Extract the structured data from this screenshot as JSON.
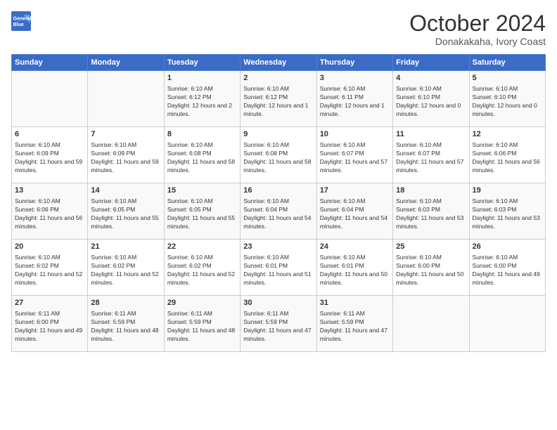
{
  "logo": {
    "line1": "General",
    "line2": "Blue"
  },
  "title": "October 2024",
  "subtitle": "Donakakaha, Ivory Coast",
  "weekdays": [
    "Sunday",
    "Monday",
    "Tuesday",
    "Wednesday",
    "Thursday",
    "Friday",
    "Saturday"
  ],
  "weeks": [
    [
      {
        "num": "",
        "sunrise": "",
        "sunset": "",
        "daylight": ""
      },
      {
        "num": "",
        "sunrise": "",
        "sunset": "",
        "daylight": ""
      },
      {
        "num": "1",
        "sunrise": "Sunrise: 6:10 AM",
        "sunset": "Sunset: 6:12 PM",
        "daylight": "Daylight: 12 hours and 2 minutes."
      },
      {
        "num": "2",
        "sunrise": "Sunrise: 6:10 AM",
        "sunset": "Sunset: 6:12 PM",
        "daylight": "Daylight: 12 hours and 1 minute."
      },
      {
        "num": "3",
        "sunrise": "Sunrise: 6:10 AM",
        "sunset": "Sunset: 6:11 PM",
        "daylight": "Daylight: 12 hours and 1 minute."
      },
      {
        "num": "4",
        "sunrise": "Sunrise: 6:10 AM",
        "sunset": "Sunset: 6:10 PM",
        "daylight": "Daylight: 12 hours and 0 minutes."
      },
      {
        "num": "5",
        "sunrise": "Sunrise: 6:10 AM",
        "sunset": "Sunset: 6:10 PM",
        "daylight": "Daylight: 12 hours and 0 minutes."
      }
    ],
    [
      {
        "num": "6",
        "sunrise": "Sunrise: 6:10 AM",
        "sunset": "Sunset: 6:09 PM",
        "daylight": "Daylight: 11 hours and 59 minutes."
      },
      {
        "num": "7",
        "sunrise": "Sunrise: 6:10 AM",
        "sunset": "Sunset: 6:09 PM",
        "daylight": "Daylight: 11 hours and 59 minutes."
      },
      {
        "num": "8",
        "sunrise": "Sunrise: 6:10 AM",
        "sunset": "Sunset: 6:08 PM",
        "daylight": "Daylight: 11 hours and 58 minutes."
      },
      {
        "num": "9",
        "sunrise": "Sunrise: 6:10 AM",
        "sunset": "Sunset: 6:08 PM",
        "daylight": "Daylight: 11 hours and 58 minutes."
      },
      {
        "num": "10",
        "sunrise": "Sunrise: 6:10 AM",
        "sunset": "Sunset: 6:07 PM",
        "daylight": "Daylight: 11 hours and 57 minutes."
      },
      {
        "num": "11",
        "sunrise": "Sunrise: 6:10 AM",
        "sunset": "Sunset: 6:07 PM",
        "daylight": "Daylight: 11 hours and 57 minutes."
      },
      {
        "num": "12",
        "sunrise": "Sunrise: 6:10 AM",
        "sunset": "Sunset: 6:06 PM",
        "daylight": "Daylight: 11 hours and 56 minutes."
      }
    ],
    [
      {
        "num": "13",
        "sunrise": "Sunrise: 6:10 AM",
        "sunset": "Sunset: 6:06 PM",
        "daylight": "Daylight: 11 hours and 56 minutes."
      },
      {
        "num": "14",
        "sunrise": "Sunrise: 6:10 AM",
        "sunset": "Sunset: 6:05 PM",
        "daylight": "Daylight: 11 hours and 55 minutes."
      },
      {
        "num": "15",
        "sunrise": "Sunrise: 6:10 AM",
        "sunset": "Sunset: 6:05 PM",
        "daylight": "Daylight: 11 hours and 55 minutes."
      },
      {
        "num": "16",
        "sunrise": "Sunrise: 6:10 AM",
        "sunset": "Sunset: 6:04 PM",
        "daylight": "Daylight: 11 hours and 54 minutes."
      },
      {
        "num": "17",
        "sunrise": "Sunrise: 6:10 AM",
        "sunset": "Sunset: 6:04 PM",
        "daylight": "Daylight: 11 hours and 54 minutes."
      },
      {
        "num": "18",
        "sunrise": "Sunrise: 6:10 AM",
        "sunset": "Sunset: 6:03 PM",
        "daylight": "Daylight: 11 hours and 53 minutes."
      },
      {
        "num": "19",
        "sunrise": "Sunrise: 6:10 AM",
        "sunset": "Sunset: 6:03 PM",
        "daylight": "Daylight: 11 hours and 53 minutes."
      }
    ],
    [
      {
        "num": "20",
        "sunrise": "Sunrise: 6:10 AM",
        "sunset": "Sunset: 6:02 PM",
        "daylight": "Daylight: 11 hours and 52 minutes."
      },
      {
        "num": "21",
        "sunrise": "Sunrise: 6:10 AM",
        "sunset": "Sunset: 6:02 PM",
        "daylight": "Daylight: 11 hours and 52 minutes."
      },
      {
        "num": "22",
        "sunrise": "Sunrise: 6:10 AM",
        "sunset": "Sunset: 6:02 PM",
        "daylight": "Daylight: 11 hours and 52 minutes."
      },
      {
        "num": "23",
        "sunrise": "Sunrise: 6:10 AM",
        "sunset": "Sunset: 6:01 PM",
        "daylight": "Daylight: 11 hours and 51 minutes."
      },
      {
        "num": "24",
        "sunrise": "Sunrise: 6:10 AM",
        "sunset": "Sunset: 6:01 PM",
        "daylight": "Daylight: 11 hours and 50 minutes."
      },
      {
        "num": "25",
        "sunrise": "Sunrise: 6:10 AM",
        "sunset": "Sunset: 6:00 PM",
        "daylight": "Daylight: 11 hours and 50 minutes."
      },
      {
        "num": "26",
        "sunrise": "Sunrise: 6:10 AM",
        "sunset": "Sunset: 6:00 PM",
        "daylight": "Daylight: 11 hours and 49 minutes."
      }
    ],
    [
      {
        "num": "27",
        "sunrise": "Sunrise: 6:11 AM",
        "sunset": "Sunset: 6:00 PM",
        "daylight": "Daylight: 11 hours and 49 minutes."
      },
      {
        "num": "28",
        "sunrise": "Sunrise: 6:11 AM",
        "sunset": "Sunset: 5:59 PM",
        "daylight": "Daylight: 11 hours and 48 minutes."
      },
      {
        "num": "29",
        "sunrise": "Sunrise: 6:11 AM",
        "sunset": "Sunset: 5:59 PM",
        "daylight": "Daylight: 11 hours and 48 minutes."
      },
      {
        "num": "30",
        "sunrise": "Sunrise: 6:11 AM",
        "sunset": "Sunset: 5:59 PM",
        "daylight": "Daylight: 11 hours and 47 minutes."
      },
      {
        "num": "31",
        "sunrise": "Sunrise: 6:11 AM",
        "sunset": "Sunset: 5:59 PM",
        "daylight": "Daylight: 11 hours and 47 minutes."
      },
      {
        "num": "",
        "sunrise": "",
        "sunset": "",
        "daylight": ""
      },
      {
        "num": "",
        "sunrise": "",
        "sunset": "",
        "daylight": ""
      }
    ]
  ]
}
